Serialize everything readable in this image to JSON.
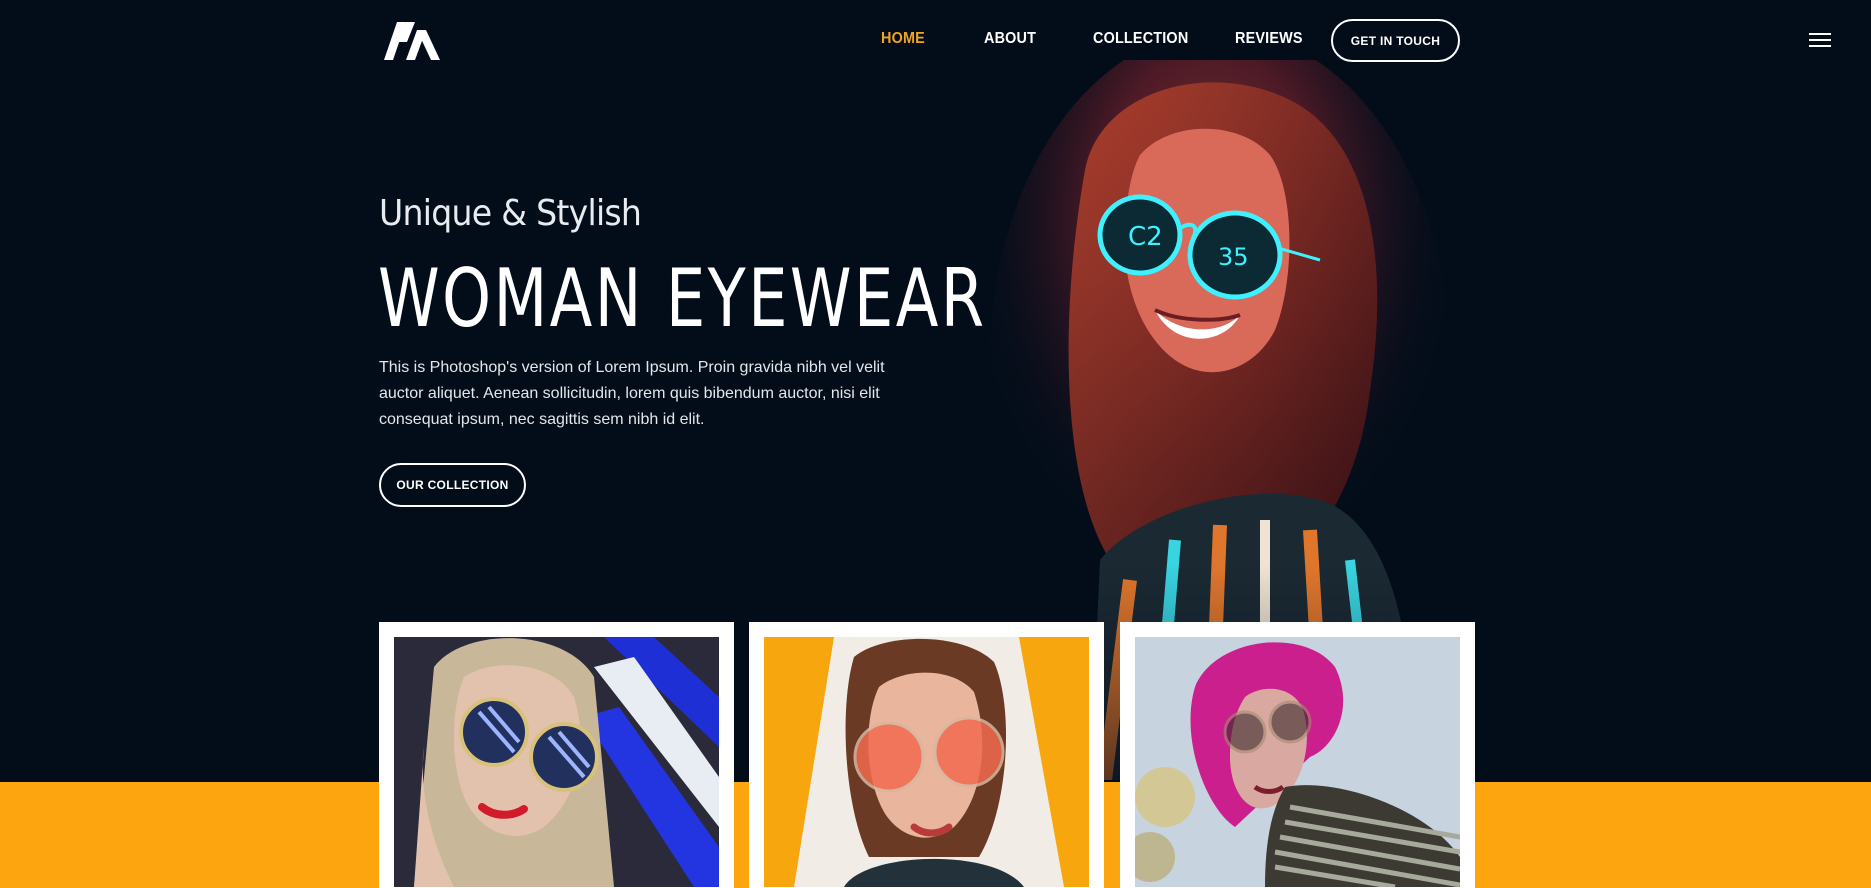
{
  "nav": {
    "logo_alt": "M logo",
    "items": [
      {
        "label": "HOME",
        "active": true
      },
      {
        "label": "ABOUT",
        "active": false
      },
      {
        "label": "COLLECTION",
        "active": false
      },
      {
        "label": "REVIEWS",
        "active": false
      }
    ],
    "cta_label": "GET IN TOUCH",
    "menu_icon": "hamburger-menu-icon"
  },
  "hero": {
    "eyebrow": "Unique & Stylish",
    "title": "WOMAN EYEWEAR",
    "description": "This is Photoshop's version of Lorem Ipsum. Proin gravida nibh vel velit auctor aliquet. Aenean sollicitudin, lorem quis bibendum auctor, nisi elit consequat ipsum, nec sagittis sem nibh id elit.",
    "button_label": "OUR COLLECTION"
  },
  "colors": {
    "background": "#030d1a",
    "accent": "#f2a41c",
    "band": "#fda50f",
    "text": "#ffffff"
  },
  "cards": [
    {
      "name": "woman-blue-round-sunglasses"
    },
    {
      "name": "woman-red-round-sunglasses"
    },
    {
      "name": "woman-pink-hair-sunglasses"
    }
  ]
}
